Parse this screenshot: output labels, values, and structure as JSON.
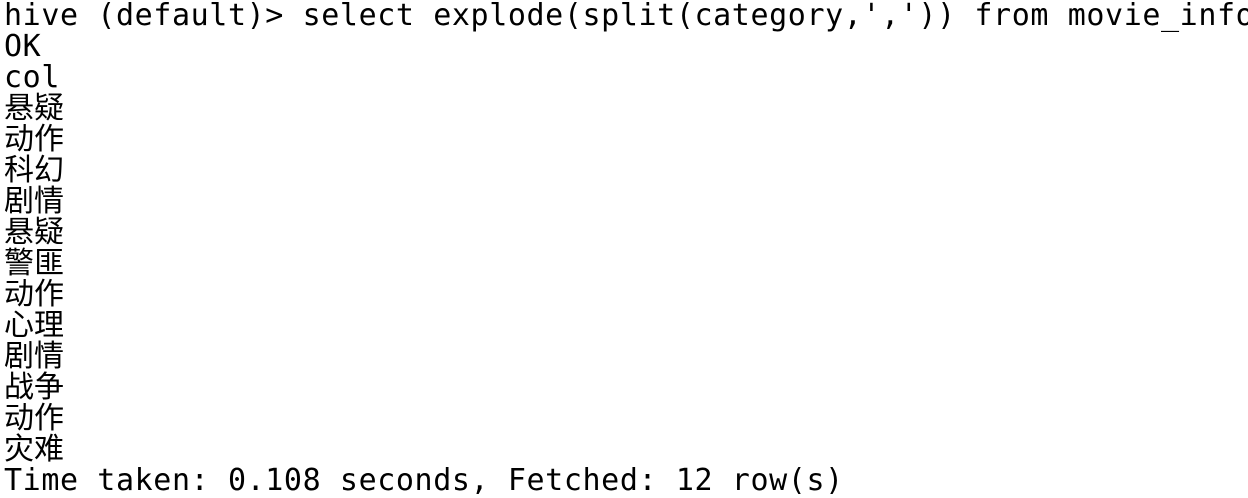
{
  "terminal": {
    "command_line": "hive (default)> select explode(split(category,',')) from movie_info;",
    "status": "OK",
    "column_header": "col",
    "rows": [
      "悬疑",
      "动作",
      "科幻",
      "剧情",
      "悬疑",
      "警匪",
      "动作",
      "心理",
      "剧情",
      "战争",
      "动作",
      "灾难"
    ],
    "summary": "Time taken: 0.108 seconds, Fetched: 12 row(s)"
  }
}
